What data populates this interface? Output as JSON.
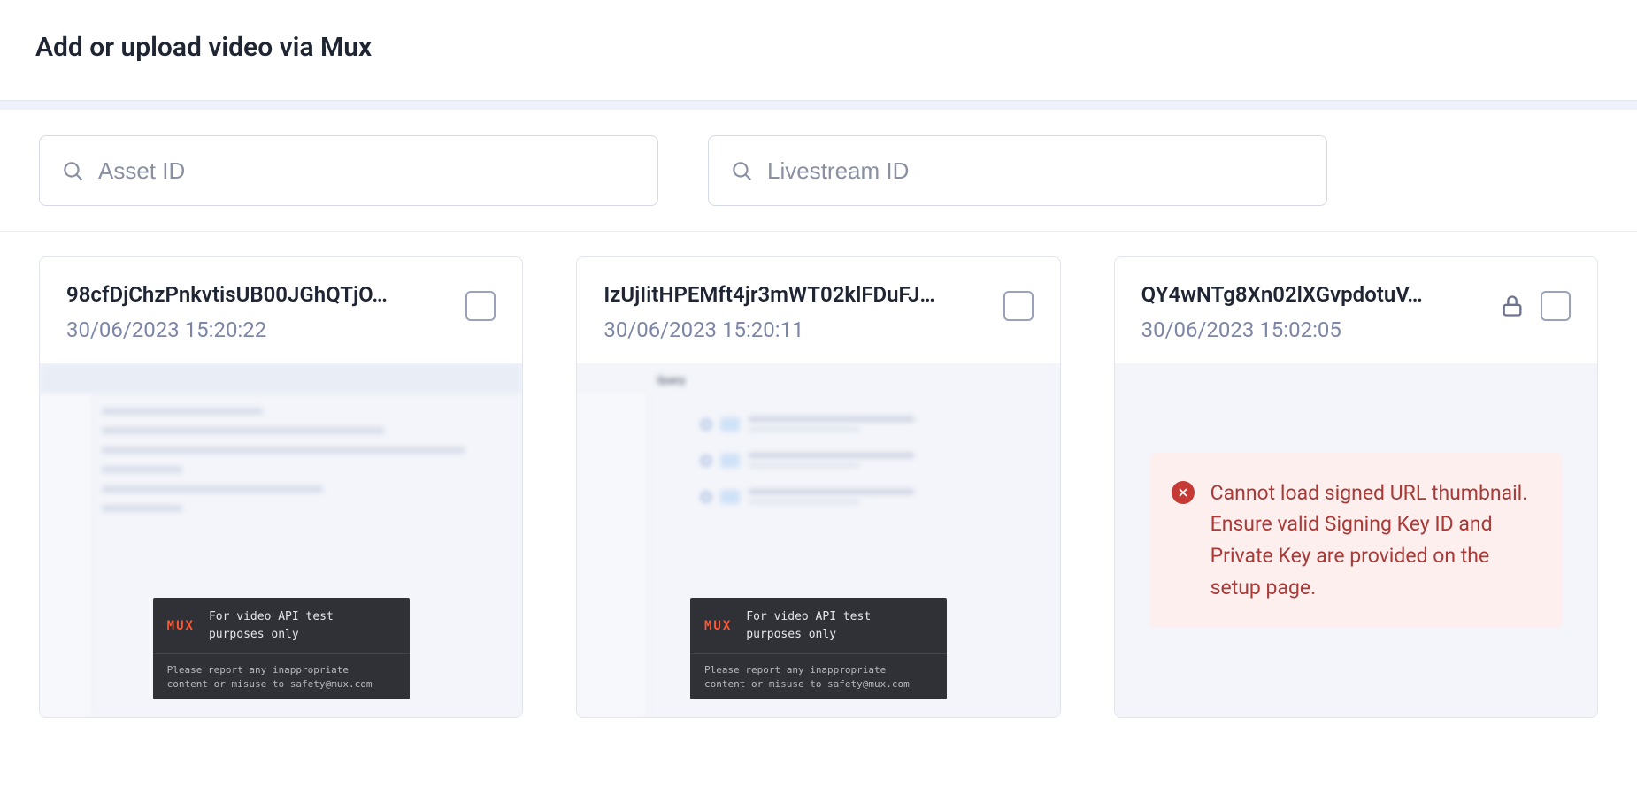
{
  "header": {
    "title": "Add or upload video via Mux"
  },
  "search": {
    "asset_placeholder": "Asset ID",
    "livestream_placeholder": "Livestream ID"
  },
  "mux_watermark": {
    "logo": "MUX",
    "line": "For video API test purposes only",
    "footer": "Please report any inappropriate content or misuse to safety@mux.com"
  },
  "error": {
    "message": "Cannot load signed URL thumbnail. Ensure valid Signing Key ID and Private Key are provided on the setup page."
  },
  "cards": [
    {
      "title": "98cfDjChzPnkvtisUB00JGhQTjO…",
      "date": "30/06/2023 15:20:22",
      "locked": false,
      "thumb": "table"
    },
    {
      "title": "IzUjIitHPEMft4jr3mWT02klFDuFJ…",
      "date": "30/06/2023 15:20:11",
      "locked": false,
      "thumb": "list"
    },
    {
      "title": "QY4wNTg8Xn02lXGvpdotuV…",
      "date": "30/06/2023 15:02:05",
      "locked": true,
      "thumb": "error"
    }
  ]
}
